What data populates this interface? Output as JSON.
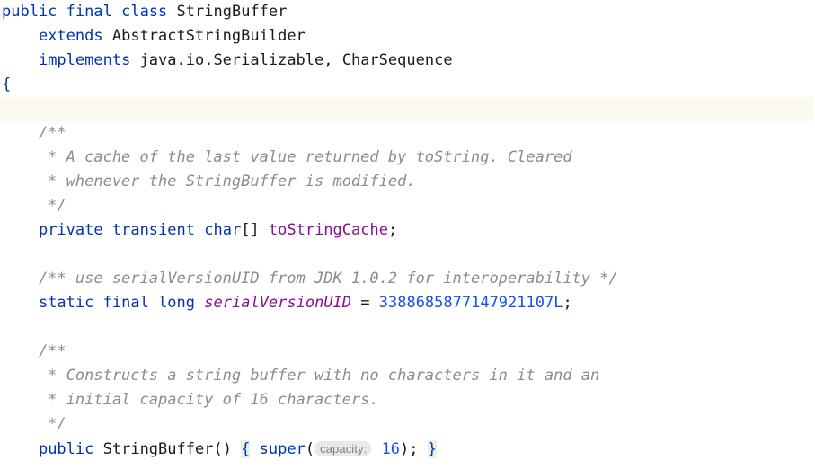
{
  "editor": {
    "language": "java",
    "file_symbol": "StringBuffer",
    "theme_colors": {
      "background": "#ffffff",
      "keyword": "#0033b3",
      "identifier": "#1a1a1a",
      "comment": "#8c8c8c",
      "field": "#871094",
      "static_field": "#871094",
      "number": "#1750eb",
      "caret_line_background": "#fbf8ee",
      "matched_brace_background": "#e7f2e0",
      "inlay_hint_background": "#e9e9e9",
      "inlay_hint_text": "#808080",
      "indent_guide": "#cdcdcd"
    },
    "lines": [
      {
        "n": 1,
        "caret": false,
        "tokens": [
          {
            "t": "kw",
            "s": "public"
          },
          {
            "t": "plain",
            "s": " "
          },
          {
            "t": "kw",
            "s": "final"
          },
          {
            "t": "plain",
            "s": " "
          },
          {
            "t": "kw",
            "s": "class"
          },
          {
            "t": "plain",
            "s": " "
          },
          {
            "t": "ident",
            "s": "StringBuffer"
          }
        ]
      },
      {
        "n": 2,
        "caret": false,
        "tokens": [
          {
            "t": "plain",
            "s": "    "
          },
          {
            "t": "kw",
            "s": "extends"
          },
          {
            "t": "plain",
            "s": " "
          },
          {
            "t": "ident",
            "s": "AbstractStringBuilder"
          }
        ]
      },
      {
        "n": 3,
        "caret": false,
        "tokens": [
          {
            "t": "plain",
            "s": "    "
          },
          {
            "t": "kw",
            "s": "implements"
          },
          {
            "t": "plain",
            "s": " "
          },
          {
            "t": "ident",
            "s": "java.io.Serializable, CharSequence"
          }
        ]
      },
      {
        "n": 4,
        "caret": false,
        "tokens": [
          {
            "t": "kw",
            "s": "{"
          }
        ]
      },
      {
        "n": 5,
        "caret": true,
        "tokens": []
      },
      {
        "n": 6,
        "caret": false,
        "tokens": [
          {
            "t": "comment",
            "s": "    /**"
          }
        ]
      },
      {
        "n": 7,
        "caret": false,
        "tokens": [
          {
            "t": "comment",
            "s": "     * A cache of the last value returned by toString. Cleared"
          }
        ]
      },
      {
        "n": 8,
        "caret": false,
        "tokens": [
          {
            "t": "comment",
            "s": "     * whenever the StringBuffer is modified."
          }
        ]
      },
      {
        "n": 9,
        "caret": false,
        "tokens": [
          {
            "t": "comment",
            "s": "     */"
          }
        ]
      },
      {
        "n": 10,
        "caret": false,
        "tokens": [
          {
            "t": "plain",
            "s": "    "
          },
          {
            "t": "kw",
            "s": "private"
          },
          {
            "t": "plain",
            "s": " "
          },
          {
            "t": "kw",
            "s": "transient"
          },
          {
            "t": "plain",
            "s": " "
          },
          {
            "t": "kw",
            "s": "char"
          },
          {
            "t": "punct",
            "s": "[] "
          },
          {
            "t": "field",
            "s": "toStringCache"
          },
          {
            "t": "punct",
            "s": ";"
          }
        ]
      },
      {
        "n": 11,
        "caret": false,
        "tokens": []
      },
      {
        "n": 12,
        "caret": false,
        "tokens": [
          {
            "t": "comment",
            "s": "    /** use serialVersionUID from JDK 1.0.2 for interoperability */"
          }
        ]
      },
      {
        "n": 13,
        "caret": false,
        "tokens": [
          {
            "t": "plain",
            "s": "    "
          },
          {
            "t": "kw",
            "s": "static"
          },
          {
            "t": "plain",
            "s": " "
          },
          {
            "t": "kw",
            "s": "final"
          },
          {
            "t": "plain",
            "s": " "
          },
          {
            "t": "kw",
            "s": "long"
          },
          {
            "t": "plain",
            "s": " "
          },
          {
            "t": "static-field",
            "s": "serialVersionUID"
          },
          {
            "t": "punct",
            "s": " = "
          },
          {
            "t": "num",
            "s": "3388685877147921107L"
          },
          {
            "t": "punct",
            "s": ";"
          }
        ]
      },
      {
        "n": 14,
        "caret": false,
        "tokens": []
      },
      {
        "n": 15,
        "caret": false,
        "tokens": [
          {
            "t": "comment",
            "s": "    /**"
          }
        ]
      },
      {
        "n": 16,
        "caret": false,
        "tokens": [
          {
            "t": "comment",
            "s": "     * Constructs a string buffer with no characters in it and an"
          }
        ]
      },
      {
        "n": 17,
        "caret": false,
        "tokens": [
          {
            "t": "comment",
            "s": "     * initial capacity of 16 characters."
          }
        ]
      },
      {
        "n": 18,
        "caret": false,
        "tokens": [
          {
            "t": "comment",
            "s": "     */"
          }
        ]
      },
      {
        "n": 19,
        "caret": false,
        "tokens": [
          {
            "t": "plain",
            "s": "    "
          },
          {
            "t": "kw",
            "s": "public"
          },
          {
            "t": "plain",
            "s": " "
          },
          {
            "t": "ident",
            "s": "StringBuffer"
          },
          {
            "t": "punct",
            "s": "() "
          },
          {
            "t": "brace-match",
            "s": "{"
          },
          {
            "t": "plain",
            "s": " "
          },
          {
            "t": "kw",
            "s": "super"
          },
          {
            "t": "punct",
            "s": "("
          },
          {
            "t": "inlay",
            "s": "capacity:"
          },
          {
            "t": "plain",
            "s": " "
          },
          {
            "t": "num",
            "s": "16"
          },
          {
            "t": "punct",
            "s": "); "
          },
          {
            "t": "brace-match",
            "s": "}"
          }
        ]
      }
    ]
  }
}
